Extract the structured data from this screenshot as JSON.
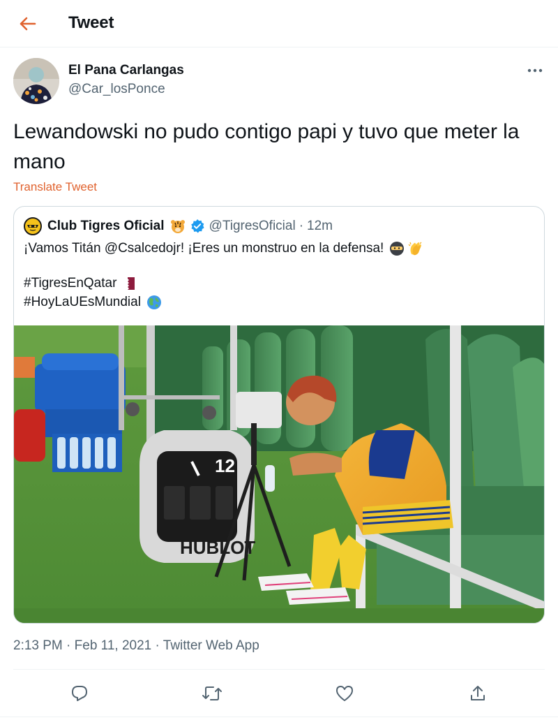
{
  "header": {
    "title": "Tweet",
    "back_icon": "arrow-left-icon",
    "accent": "#e0622e"
  },
  "author": {
    "name": "El Pana Carlangas",
    "handle": "@Car_losPonce"
  },
  "tweet": {
    "text": "Lewandowski no pudo contigo papi y tuvo que meter la mano",
    "translate_label": "Translate Tweet"
  },
  "quoted": {
    "name": "Club Tigres Oficial",
    "handle": "@TigresOficial",
    "separator": "·",
    "time": "12m",
    "line1": "¡Vamos Titán @Csalcedojr! ¡Eres un monstruo en la defensa!",
    "hashtag1": "#TigresEnQatar",
    "hashtag2": "#HoyLaUEsMundial",
    "photo": {
      "clock_number": "12",
      "brand": "HUBLOT"
    }
  },
  "meta": {
    "time": "2:13 PM",
    "sep1": "·",
    "date": "Feb 11, 2021",
    "sep2": "·",
    "app": "Twitter Web App"
  },
  "actions": {
    "reply_icon": "reply-icon",
    "retweet_icon": "retweet-icon",
    "like_icon": "heart-icon",
    "share_icon": "share-icon"
  }
}
